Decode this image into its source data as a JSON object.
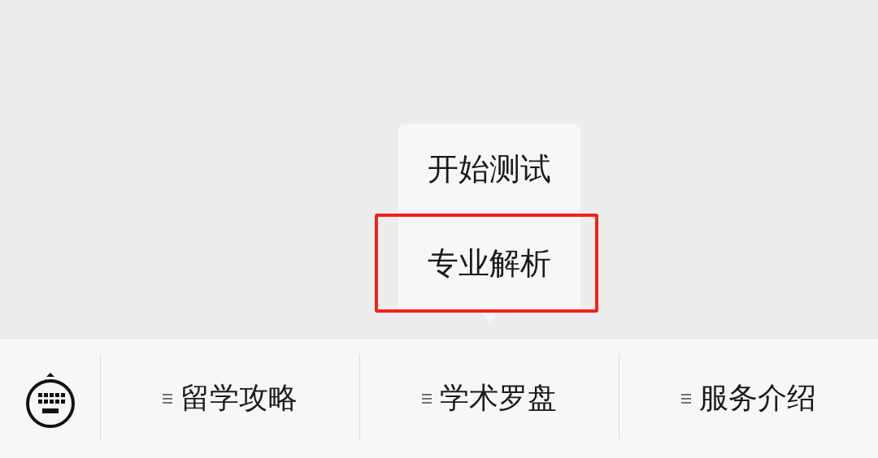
{
  "menu_bar": {
    "items": [
      {
        "label": "留学攻略"
      },
      {
        "label": "学术罗盘",
        "submenu": [
          {
            "label": "开始测试",
            "highlighted": false
          },
          {
            "label": "专业解析",
            "highlighted": true
          }
        ]
      },
      {
        "label": "服务介绍"
      }
    ]
  }
}
